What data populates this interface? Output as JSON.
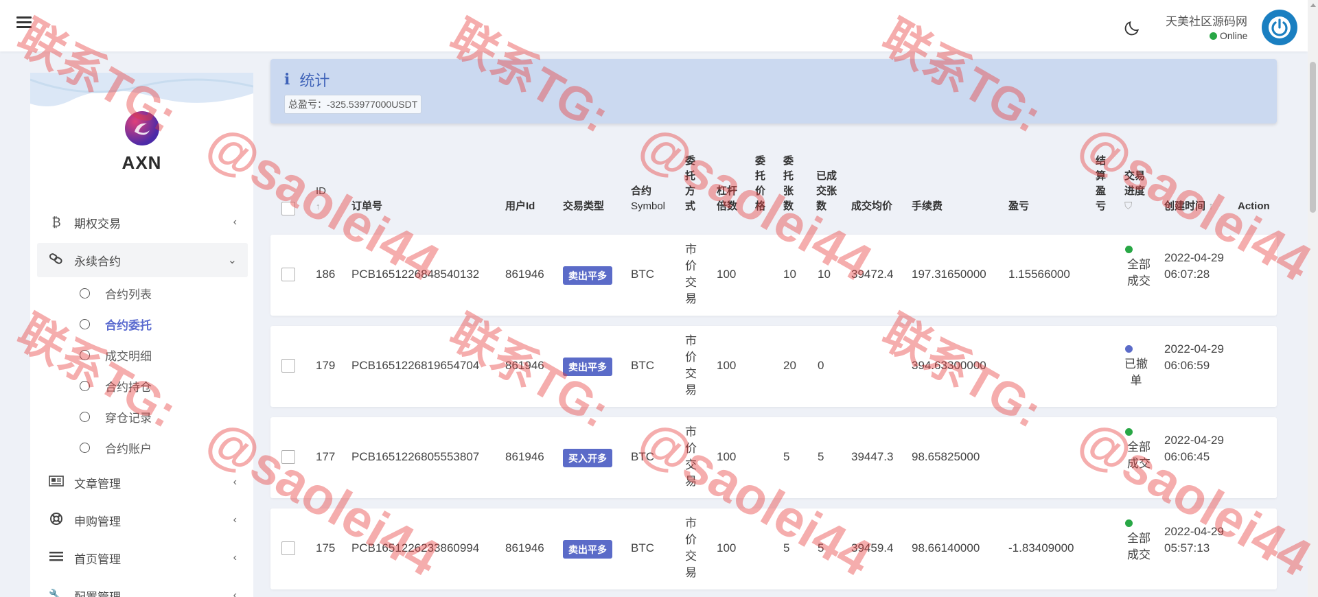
{
  "topbar": {
    "site_name": "天美社区源码网",
    "status": "Online"
  },
  "sidebar": {
    "brand": "AXN",
    "menu": [
      {
        "label": "期权交易",
        "icon": "bitcoin-icon"
      },
      {
        "label": "永续合约",
        "icon": "link-icon",
        "open": true
      },
      {
        "label": "文章管理",
        "icon": "newspaper-icon"
      },
      {
        "label": "申购管理",
        "icon": "lifebuoy-icon"
      },
      {
        "label": "首页管理",
        "icon": "list-icon"
      },
      {
        "label": "配置管理",
        "icon": "wrench-icon"
      }
    ],
    "submenu": [
      {
        "label": "合约列表"
      },
      {
        "label": "合约委托",
        "active": true
      },
      {
        "label": "成交明细"
      },
      {
        "label": "合约持仓"
      },
      {
        "label": "穿仓记录"
      },
      {
        "label": "合约账户"
      }
    ]
  },
  "stats": {
    "title": "统计",
    "total_pnl": "总盈亏：-325.53977000USDT"
  },
  "table": {
    "headers": {
      "id": "ID",
      "order_no": "订单号",
      "user_id": "用户Id",
      "trade_type": "交易类型",
      "symbol_1": "合约",
      "symbol_2": "Symbol",
      "order_method": "委托方式",
      "leverage_1": "杠杆",
      "leverage_2": "倍数",
      "order_price": "委托价格",
      "order_qty": "委托张数",
      "filled_qty_1": "已成",
      "filled_qty_2": "交张",
      "filled_qty_3": "数",
      "avg_price": "成交均价",
      "fee": "手续费",
      "pnl": "盈亏",
      "settle_pnl": "结算盈亏",
      "progress_1": "交易",
      "progress_2": "进度",
      "created": "创建时间",
      "action": "Action"
    },
    "rows": [
      {
        "id": "186",
        "order_no": "PCB1651226848540132",
        "user_id": "861946",
        "trade_type": "卖出平多",
        "symbol": "BTC",
        "method": "市价交易",
        "leverage": "100",
        "qty": "10",
        "filled": "10",
        "avg_price": "39472.4",
        "fee": "197.31650000",
        "pnl": "1.15566000",
        "status": "全部成交",
        "status_color": "#28a745",
        "date": "2022-04-29",
        "time": "06:07:28"
      },
      {
        "id": "179",
        "order_no": "PCB1651226819654704",
        "user_id": "861946",
        "trade_type": "卖出平多",
        "symbol": "BTC",
        "method": "市价交易",
        "leverage": "100",
        "qty": "20",
        "filled": "0",
        "avg_price": "",
        "fee": "394.63300000",
        "pnl": "",
        "status": "已撤单",
        "status_color": "#5b6bc8",
        "date": "2022-04-29",
        "time": "06:06:59"
      },
      {
        "id": "177",
        "order_no": "PCB1651226805553807",
        "user_id": "861946",
        "trade_type": "买入开多",
        "symbol": "BTC",
        "method": "市价交易",
        "leverage": "100",
        "qty": "5",
        "filled": "5",
        "avg_price": "39447.3",
        "fee": "98.65825000",
        "pnl": "",
        "status": "全部成交",
        "status_color": "#28a745",
        "date": "2022-04-29",
        "time": "06:06:45"
      },
      {
        "id": "175",
        "order_no": "PCB1651226233860994",
        "user_id": "861946",
        "trade_type": "卖出平多",
        "symbol": "BTC",
        "method": "市价交易",
        "leverage": "100",
        "qty": "5",
        "filled": "5",
        "avg_price": "39459.4",
        "fee": "98.66140000",
        "pnl": "-1.83409000",
        "status": "全部成交",
        "status_color": "#28a745",
        "date": "2022-04-29",
        "time": "05:57:13"
      }
    ]
  },
  "watermark": {
    "line1": "联系TG:",
    "line2": "@saolei44"
  }
}
